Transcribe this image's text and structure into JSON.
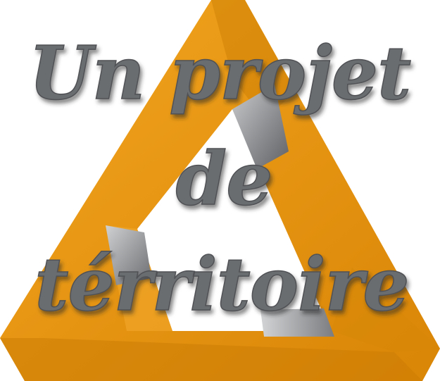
{
  "logo": {
    "title_lines": [
      "Un projet",
      "de",
      "térritoire"
    ]
  },
  "colors": {
    "orange_main": "#e8920a",
    "orange_light": "#f0a21c",
    "orange_dark": "#c47a05",
    "gray_light": "#b9bbbd",
    "gray_dark": "#6d6f72",
    "text_fill": "#6b6d70",
    "text_shadow": "#3a3b3d"
  }
}
